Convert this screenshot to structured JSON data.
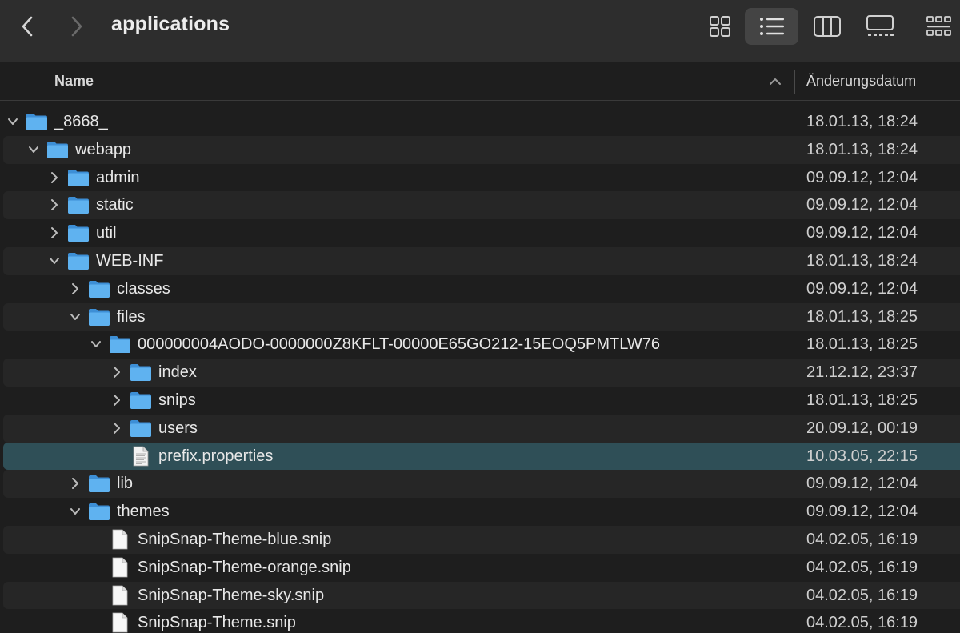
{
  "window": {
    "title": "applications"
  },
  "toolbar": {
    "back_icon": "chevron-left-icon",
    "forward_icon": "chevron-right-icon",
    "view_modes": [
      "icon-view",
      "list-view",
      "column-view",
      "gallery-view",
      "more-view"
    ],
    "active_view": "list-view"
  },
  "header": {
    "name_label": "Name",
    "date_label": "Änderungsdatum",
    "sort_icon": "chevron-up-icon"
  },
  "colors": {
    "folder": "#5fb2f0",
    "selected_row": "#2f4f57",
    "alt_row": "#262626"
  },
  "files": [
    {
      "name": "_8668_",
      "date": "18.01.13, 18:24",
      "depth": 0,
      "kind": "folder",
      "expanded": true
    },
    {
      "name": "webapp",
      "date": "18.01.13, 18:24",
      "depth": 1,
      "kind": "folder",
      "expanded": true
    },
    {
      "name": "admin",
      "date": "09.09.12, 12:04",
      "depth": 2,
      "kind": "folder",
      "expanded": false
    },
    {
      "name": "static",
      "date": "09.09.12, 12:04",
      "depth": 2,
      "kind": "folder",
      "expanded": false
    },
    {
      "name": "util",
      "date": "09.09.12, 12:04",
      "depth": 2,
      "kind": "folder",
      "expanded": false
    },
    {
      "name": "WEB-INF",
      "date": "18.01.13, 18:24",
      "depth": 2,
      "kind": "folder",
      "expanded": true
    },
    {
      "name": "classes",
      "date": "09.09.12, 12:04",
      "depth": 3,
      "kind": "folder",
      "expanded": false
    },
    {
      "name": "files",
      "date": "18.01.13, 18:25",
      "depth": 3,
      "kind": "folder",
      "expanded": true
    },
    {
      "name": "000000004AODO-0000000Z8KFLT-00000E65GO212-15EOQ5PMTLW76",
      "date": "18.01.13, 18:25",
      "depth": 4,
      "kind": "folder",
      "expanded": true
    },
    {
      "name": "index",
      "date": "21.12.12, 23:37",
      "depth": 5,
      "kind": "folder",
      "expanded": false
    },
    {
      "name": "snips",
      "date": "18.01.13, 18:25",
      "depth": 5,
      "kind": "folder",
      "expanded": false
    },
    {
      "name": "users",
      "date": "20.09.12, 00:19",
      "depth": 5,
      "kind": "folder",
      "expanded": false
    },
    {
      "name": "prefix.properties",
      "date": "10.03.05, 22:15",
      "depth": 5,
      "kind": "text-file",
      "selected": true
    },
    {
      "name": "lib",
      "date": "09.09.12, 12:04",
      "depth": 3,
      "kind": "folder",
      "expanded": false
    },
    {
      "name": "themes",
      "date": "09.09.12, 12:04",
      "depth": 3,
      "kind": "folder",
      "expanded": true
    },
    {
      "name": "SnipSnap-Theme-blue.snip",
      "date": "04.02.05, 16:19",
      "depth": 4,
      "kind": "blank-file"
    },
    {
      "name": "SnipSnap-Theme-orange.snip",
      "date": "04.02.05, 16:19",
      "depth": 4,
      "kind": "blank-file"
    },
    {
      "name": "SnipSnap-Theme-sky.snip",
      "date": "04.02.05, 16:19",
      "depth": 4,
      "kind": "blank-file"
    },
    {
      "name": "SnipSnap-Theme.snip",
      "date": "04.02.05, 16:19",
      "depth": 4,
      "kind": "blank-file"
    }
  ]
}
